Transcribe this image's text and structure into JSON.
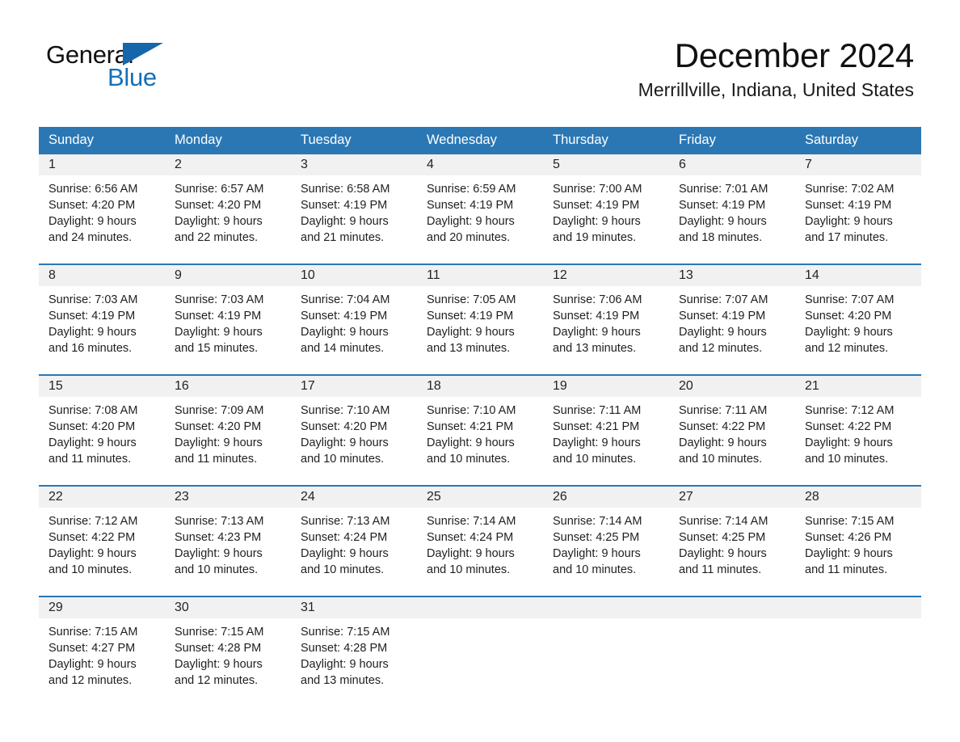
{
  "brand": {
    "name_part1": "General",
    "name_part2": "Blue",
    "logo_mark": "triangle-mark",
    "color_blue": "#1570b8"
  },
  "header": {
    "month_title": "December 2024",
    "location": "Merrillville, Indiana, United States"
  },
  "theme": {
    "header_blue": "#2b77b4",
    "row_divider": "#2b77b4",
    "daynum_band": "#f1f1f1",
    "text": "#1f1f1f"
  },
  "calendar": {
    "weekday_headers": [
      "Sunday",
      "Monday",
      "Tuesday",
      "Wednesday",
      "Thursday",
      "Friday",
      "Saturday"
    ],
    "weeks": [
      [
        {
          "day": "1",
          "lines": [
            "Sunrise: 6:56 AM",
            "Sunset: 4:20 PM",
            "Daylight: 9 hours",
            "and 24 minutes."
          ]
        },
        {
          "day": "2",
          "lines": [
            "Sunrise: 6:57 AM",
            "Sunset: 4:20 PM",
            "Daylight: 9 hours",
            "and 22 minutes."
          ]
        },
        {
          "day": "3",
          "lines": [
            "Sunrise: 6:58 AM",
            "Sunset: 4:19 PM",
            "Daylight: 9 hours",
            "and 21 minutes."
          ]
        },
        {
          "day": "4",
          "lines": [
            "Sunrise: 6:59 AM",
            "Sunset: 4:19 PM",
            "Daylight: 9 hours",
            "and 20 minutes."
          ]
        },
        {
          "day": "5",
          "lines": [
            "Sunrise: 7:00 AM",
            "Sunset: 4:19 PM",
            "Daylight: 9 hours",
            "and 19 minutes."
          ]
        },
        {
          "day": "6",
          "lines": [
            "Sunrise: 7:01 AM",
            "Sunset: 4:19 PM",
            "Daylight: 9 hours",
            "and 18 minutes."
          ]
        },
        {
          "day": "7",
          "lines": [
            "Sunrise: 7:02 AM",
            "Sunset: 4:19 PM",
            "Daylight: 9 hours",
            "and 17 minutes."
          ]
        }
      ],
      [
        {
          "day": "8",
          "lines": [
            "Sunrise: 7:03 AM",
            "Sunset: 4:19 PM",
            "Daylight: 9 hours",
            "and 16 minutes."
          ]
        },
        {
          "day": "9",
          "lines": [
            "Sunrise: 7:03 AM",
            "Sunset: 4:19 PM",
            "Daylight: 9 hours",
            "and 15 minutes."
          ]
        },
        {
          "day": "10",
          "lines": [
            "Sunrise: 7:04 AM",
            "Sunset: 4:19 PM",
            "Daylight: 9 hours",
            "and 14 minutes."
          ]
        },
        {
          "day": "11",
          "lines": [
            "Sunrise: 7:05 AM",
            "Sunset: 4:19 PM",
            "Daylight: 9 hours",
            "and 13 minutes."
          ]
        },
        {
          "day": "12",
          "lines": [
            "Sunrise: 7:06 AM",
            "Sunset: 4:19 PM",
            "Daylight: 9 hours",
            "and 13 minutes."
          ]
        },
        {
          "day": "13",
          "lines": [
            "Sunrise: 7:07 AM",
            "Sunset: 4:19 PM",
            "Daylight: 9 hours",
            "and 12 minutes."
          ]
        },
        {
          "day": "14",
          "lines": [
            "Sunrise: 7:07 AM",
            "Sunset: 4:20 PM",
            "Daylight: 9 hours",
            "and 12 minutes."
          ]
        }
      ],
      [
        {
          "day": "15",
          "lines": [
            "Sunrise: 7:08 AM",
            "Sunset: 4:20 PM",
            "Daylight: 9 hours",
            "and 11 minutes."
          ]
        },
        {
          "day": "16",
          "lines": [
            "Sunrise: 7:09 AM",
            "Sunset: 4:20 PM",
            "Daylight: 9 hours",
            "and 11 minutes."
          ]
        },
        {
          "day": "17",
          "lines": [
            "Sunrise: 7:10 AM",
            "Sunset: 4:20 PM",
            "Daylight: 9 hours",
            "and 10 minutes."
          ]
        },
        {
          "day": "18",
          "lines": [
            "Sunrise: 7:10 AM",
            "Sunset: 4:21 PM",
            "Daylight: 9 hours",
            "and 10 minutes."
          ]
        },
        {
          "day": "19",
          "lines": [
            "Sunrise: 7:11 AM",
            "Sunset: 4:21 PM",
            "Daylight: 9 hours",
            "and 10 minutes."
          ]
        },
        {
          "day": "20",
          "lines": [
            "Sunrise: 7:11 AM",
            "Sunset: 4:22 PM",
            "Daylight: 9 hours",
            "and 10 minutes."
          ]
        },
        {
          "day": "21",
          "lines": [
            "Sunrise: 7:12 AM",
            "Sunset: 4:22 PM",
            "Daylight: 9 hours",
            "and 10 minutes."
          ]
        }
      ],
      [
        {
          "day": "22",
          "lines": [
            "Sunrise: 7:12 AM",
            "Sunset: 4:22 PM",
            "Daylight: 9 hours",
            "and 10 minutes."
          ]
        },
        {
          "day": "23",
          "lines": [
            "Sunrise: 7:13 AM",
            "Sunset: 4:23 PM",
            "Daylight: 9 hours",
            "and 10 minutes."
          ]
        },
        {
          "day": "24",
          "lines": [
            "Sunrise: 7:13 AM",
            "Sunset: 4:24 PM",
            "Daylight: 9 hours",
            "and 10 minutes."
          ]
        },
        {
          "day": "25",
          "lines": [
            "Sunrise: 7:14 AM",
            "Sunset: 4:24 PM",
            "Daylight: 9 hours",
            "and 10 minutes."
          ]
        },
        {
          "day": "26",
          "lines": [
            "Sunrise: 7:14 AM",
            "Sunset: 4:25 PM",
            "Daylight: 9 hours",
            "and 10 minutes."
          ]
        },
        {
          "day": "27",
          "lines": [
            "Sunrise: 7:14 AM",
            "Sunset: 4:25 PM",
            "Daylight: 9 hours",
            "and 11 minutes."
          ]
        },
        {
          "day": "28",
          "lines": [
            "Sunrise: 7:15 AM",
            "Sunset: 4:26 PM",
            "Daylight: 9 hours",
            "and 11 minutes."
          ]
        }
      ],
      [
        {
          "day": "29",
          "lines": [
            "Sunrise: 7:15 AM",
            "Sunset: 4:27 PM",
            "Daylight: 9 hours",
            "and 12 minutes."
          ]
        },
        {
          "day": "30",
          "lines": [
            "Sunrise: 7:15 AM",
            "Sunset: 4:28 PM",
            "Daylight: 9 hours",
            "and 12 minutes."
          ]
        },
        {
          "day": "31",
          "lines": [
            "Sunrise: 7:15 AM",
            "Sunset: 4:28 PM",
            "Daylight: 9 hours",
            "and 13 minutes."
          ]
        },
        {
          "day": "",
          "lines": []
        },
        {
          "day": "",
          "lines": []
        },
        {
          "day": "",
          "lines": []
        },
        {
          "day": "",
          "lines": []
        }
      ]
    ]
  }
}
